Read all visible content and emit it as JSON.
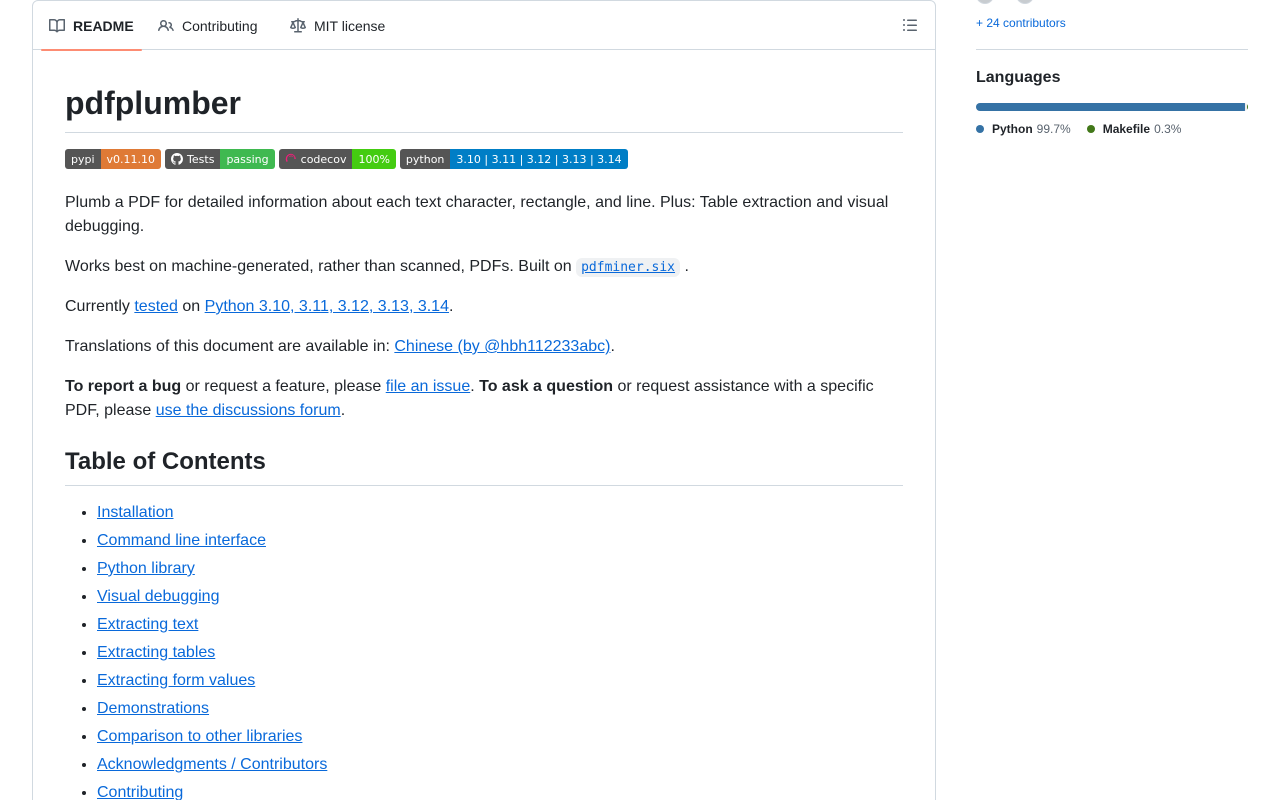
{
  "tabs": [
    {
      "label": "README",
      "icon": "book-icon",
      "active": true
    },
    {
      "label": "Contributing",
      "icon": "people-icon",
      "active": false
    },
    {
      "label": "MIT license",
      "icon": "law-icon",
      "active": false
    }
  ],
  "readme": {
    "title": "pdfplumber",
    "badges": [
      {
        "left": "pypi",
        "right": "v0.11.10"
      },
      {
        "left": "Tests",
        "right": "passing"
      },
      {
        "left": "codecov",
        "right": "100%"
      },
      {
        "left": "python",
        "right": "3.10 | 3.11 | 3.12 | 3.13 | 3.14"
      }
    ],
    "p1": "Plumb a PDF for detailed information about each text character, rectangle, and line. Plus: Table extraction and visual debugging.",
    "p2_prefix": "Works best on machine-generated, rather than scanned, PDFs. Built on ",
    "p2_code": "pdfminer.six",
    "p2_suffix": ".",
    "p3_prefix": "Currently ",
    "p3_link1": "tested",
    "p3_mid": " on ",
    "p3_link2": "Python 3.10, 3.11, 3.12, 3.13, 3.14",
    "p3_suffix": ".",
    "p4_prefix": "Translations of this document are available in: ",
    "p4_link": "Chinese (by @hbh112233abc)",
    "p4_suffix": ".",
    "p5_bold1": "To report a bug",
    "p5_text1": " or request a feature, please ",
    "p5_link1": "file an issue",
    "p5_text2": ". ",
    "p5_bold2": "To ask a question",
    "p5_text3": " or request assistance with a specific PDF, please ",
    "p5_link2": "use the discussions forum",
    "p5_suffix": ".",
    "toc_title": "Table of Contents",
    "toc": [
      "Installation",
      "Command line interface",
      "Python library",
      "Visual debugging",
      "Extracting text",
      "Extracting tables",
      "Extracting form values",
      "Demonstrations",
      "Comparison to other libraries",
      "Acknowledgments / Contributors",
      "Contributing"
    ]
  },
  "sidebar": {
    "contributors_link": "+ 24 contributors",
    "languages_title": "Languages",
    "languages": [
      {
        "name": "Python",
        "pct": "99.7%",
        "color": "#3572A5",
        "value": 99.7
      },
      {
        "name": "Makefile",
        "pct": "0.3%",
        "color": "#427819",
        "value": 0.3
      }
    ]
  }
}
